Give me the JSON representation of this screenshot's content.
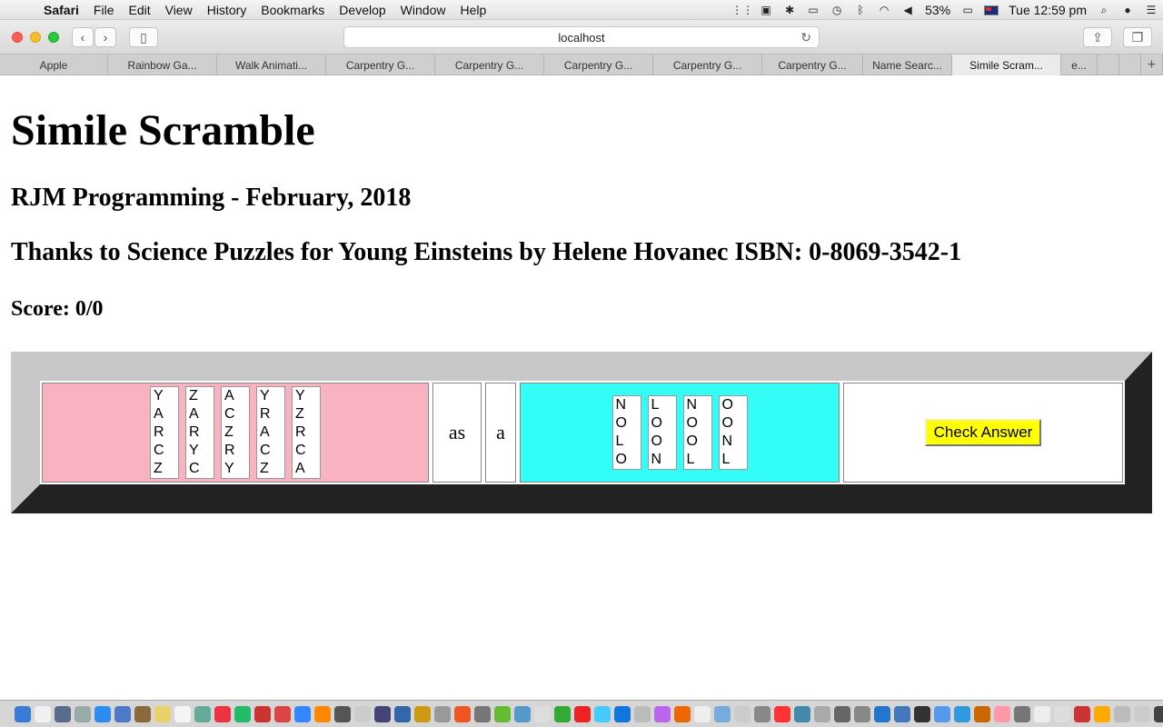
{
  "menubar": {
    "app_name": "Safari",
    "items": [
      "File",
      "Edit",
      "View",
      "History",
      "Bookmarks",
      "Develop",
      "Window",
      "Help"
    ],
    "battery": "53%",
    "clock": "Tue 12:59 pm"
  },
  "browser": {
    "url": "localhost",
    "tabs": [
      {
        "label": "Apple",
        "active": false
      },
      {
        "label": "Rainbow Ga...",
        "active": false
      },
      {
        "label": "Walk Animati...",
        "active": false
      },
      {
        "label": "Carpentry G...",
        "active": false
      },
      {
        "label": "Carpentry G...",
        "active": false
      },
      {
        "label": "Carpentry G...",
        "active": false
      },
      {
        "label": "Carpentry G...",
        "active": false
      },
      {
        "label": "Carpentry G...",
        "active": false
      },
      {
        "label": "Name Searc...",
        "active": false
      },
      {
        "label": "Simile Scram...",
        "active": true
      },
      {
        "label": "e...",
        "active": false
      }
    ]
  },
  "page": {
    "title": "Simile Scramble",
    "subtitle": "RJM Programming - February, 2018",
    "credit": "Thanks to Science Puzzles for Young Einsteins by Helene Hovanec ISBN: 0-8069-3542-1",
    "score_label": "Score: 0/0"
  },
  "game": {
    "colors": {
      "left_cell": "#f8b3c1",
      "right_cell": "#33fdf7",
      "button": "#ffff00"
    },
    "left_tiles": [
      [
        "Y",
        "A",
        "R",
        "C",
        "Z"
      ],
      [
        "Z",
        "A",
        "R",
        "Y",
        "C"
      ],
      [
        "A",
        "C",
        "Z",
        "R",
        "Y"
      ],
      [
        "Y",
        "R",
        "A",
        "C",
        "Z"
      ],
      [
        "Y",
        "Z",
        "R",
        "C",
        "A"
      ]
    ],
    "word_as": "as",
    "word_a": "a",
    "right_tiles": [
      [
        "N",
        "O",
        "L",
        "O"
      ],
      [
        "L",
        "O",
        "O",
        "N"
      ],
      [
        "N",
        "O",
        "O",
        "L"
      ],
      [
        "O",
        "O",
        "N",
        "L"
      ]
    ],
    "check_label": "Check Answer"
  }
}
